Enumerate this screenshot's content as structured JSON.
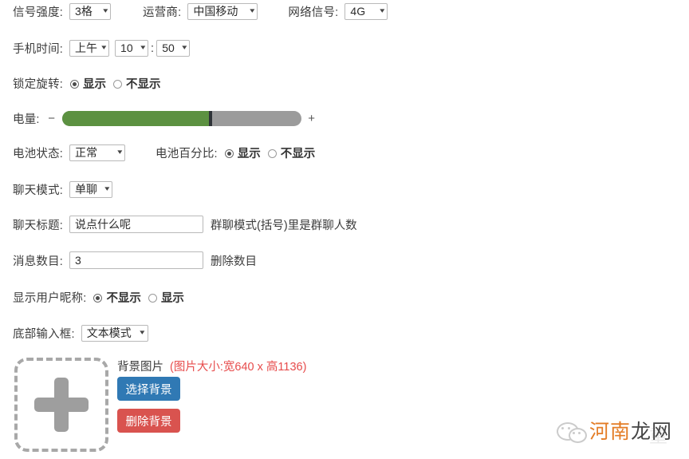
{
  "rows": {
    "signal": {
      "label": "信号强度:",
      "value": "3格",
      "carrier_label": "运营商:",
      "carrier_value": "中国移动",
      "network_label": "网络信号:",
      "network_value": "4G"
    },
    "time": {
      "label": "手机时间:",
      "ampm": "上午",
      "hour": "10",
      "separator": ":",
      "minute": "50"
    },
    "rotation": {
      "label": "锁定旋转:",
      "option_on": "显示",
      "option_off": "不显示",
      "selected": "显示"
    },
    "battery": {
      "label": "电量:",
      "minus": "−",
      "plus": "+",
      "percent": 62
    },
    "battery_state": {
      "label": "电池状态:",
      "value": "正常",
      "percent_label": "电池百分比:",
      "option_on": "显示",
      "option_off": "不显示",
      "selected": "显示"
    },
    "chat_mode": {
      "label": "聊天模式:",
      "value": "单聊"
    },
    "chat_title": {
      "label": "聊天标题:",
      "value": "说点什么呢",
      "hint": "群聊模式(括号)里是群聊人数"
    },
    "message_count": {
      "label": "消息数目:",
      "value": "3",
      "hint": "删除数目"
    },
    "nickname": {
      "label": "显示用户昵称:",
      "option_off": "不显示",
      "option_on": "显示",
      "selected": "不显示"
    },
    "input_box": {
      "label": "底部输入框:",
      "value": "文本模式"
    }
  },
  "upload": {
    "plus_icon": "plus-icon",
    "bg_label": "背景图片",
    "bg_size_hint": "(图片大小:宽640 x 高1136)",
    "choose_button": "选择背景",
    "delete_button": "删除背景"
  },
  "watermark": {
    "brand_orange": "河南",
    "brand_dark": "龙网",
    "ghost": "重"
  },
  "colors": {
    "slider_fill": "#5c9141",
    "slider_track": "#9b9b9b",
    "slider_thumb": "#2e3338",
    "choose_button": "#3079b4",
    "delete_button": "#d9534f",
    "hint_red": "#e74c4c",
    "brand_orange": "#e2761b"
  }
}
